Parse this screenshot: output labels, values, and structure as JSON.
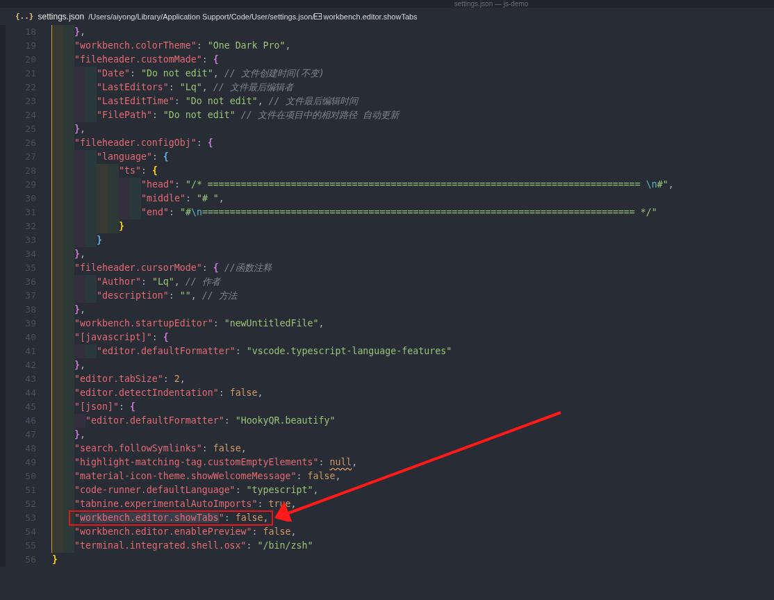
{
  "window": {
    "title": "settings.json — js-demo"
  },
  "breadcrumb": {
    "file_icon": "{..}",
    "file": "settings.json",
    "path": "/Users/aiyong/Library/Application Support/Code/User/settings.json/",
    "symbol": "workbench.editor.showTabs"
  },
  "editor": {
    "lines": [
      {
        "number": "18",
        "tokens": [
          {
            "kind": "close-bracket",
            "text": "}",
            "color": "#c678dd"
          },
          {
            "kind": "punct",
            "text": ","
          }
        ]
      },
      {
        "number": "19",
        "tokens": [
          {
            "kind": "key",
            "text": "\"workbench.colorTheme\""
          },
          {
            "kind": "punct",
            "text": ": "
          },
          {
            "kind": "string",
            "text": "\"One Dark Pro\""
          },
          {
            "kind": "punct",
            "text": ","
          }
        ]
      },
      {
        "number": "20",
        "tokens": [
          {
            "kind": "key",
            "text": "\"fileheader.customMade\""
          },
          {
            "kind": "punct",
            "text": ": "
          },
          {
            "kind": "open-bracket",
            "text": "{",
            "color": "#c678dd"
          }
        ]
      },
      {
        "number": "21",
        "tokens": [
          {
            "kind": "key",
            "text": "\"Date\""
          },
          {
            "kind": "punct",
            "text": ": "
          },
          {
            "kind": "string",
            "text": "\"Do not edit\""
          },
          {
            "kind": "punct",
            "text": ", "
          },
          {
            "kind": "comment",
            "text": "// 文件创建时间(不变)"
          }
        ]
      },
      {
        "number": "22",
        "tokens": [
          {
            "kind": "key",
            "text": "\"LastEditors\""
          },
          {
            "kind": "punct",
            "text": ": "
          },
          {
            "kind": "string",
            "text": "\"Lq\""
          },
          {
            "kind": "punct",
            "text": ", "
          },
          {
            "kind": "comment",
            "text": "// 文件最后编辑者"
          }
        ]
      },
      {
        "number": "23",
        "tokens": [
          {
            "kind": "key",
            "text": "\"LastEditTime\""
          },
          {
            "kind": "punct",
            "text": ": "
          },
          {
            "kind": "string",
            "text": "\"Do not edit\""
          },
          {
            "kind": "punct",
            "text": ", "
          },
          {
            "kind": "comment",
            "text": "// 文件最后编辑时间"
          }
        ]
      },
      {
        "number": "24",
        "tokens": [
          {
            "kind": "key",
            "text": "\"FilePath\""
          },
          {
            "kind": "punct",
            "text": ": "
          },
          {
            "kind": "string",
            "text": "\"Do not edit\" "
          },
          {
            "kind": "comment",
            "text": "// 文件在项目中的相对路径 自动更新"
          }
        ]
      },
      {
        "number": "25",
        "tokens": [
          {
            "kind": "close-bracket",
            "text": "}",
            "color": "#c678dd"
          },
          {
            "kind": "punct",
            "text": ","
          }
        ]
      },
      {
        "number": "26",
        "tokens": [
          {
            "kind": "key",
            "text": "\"fileheader.configObj\""
          },
          {
            "kind": "punct",
            "text": ": "
          },
          {
            "kind": "open-bracket",
            "text": "{",
            "color": "#c678dd"
          }
        ]
      },
      {
        "number": "27",
        "tokens": [
          {
            "kind": "key",
            "text": "\"language\""
          },
          {
            "kind": "punct",
            "text": ": "
          },
          {
            "kind": "open-bracket",
            "text": "{",
            "color": "#61afef"
          }
        ]
      },
      {
        "number": "28",
        "tokens": [
          {
            "kind": "key",
            "text": "\"ts\""
          },
          {
            "kind": "punct",
            "text": ": "
          },
          {
            "kind": "open-bracket",
            "text": "{",
            "color": "#ffd700"
          }
        ]
      },
      {
        "number": "29",
        "tokens": [
          {
            "kind": "key",
            "text": "\"head\""
          },
          {
            "kind": "punct",
            "text": ": "
          },
          {
            "kind": "string",
            "text": "\"/* ============================================================================== "
          },
          {
            "kind": "escape",
            "text": "\\n"
          },
          {
            "kind": "string",
            "text": "#\""
          },
          {
            "kind": "punct",
            "text": ","
          }
        ]
      },
      {
        "number": "30",
        "tokens": [
          {
            "kind": "key",
            "text": "\"middle\""
          },
          {
            "kind": "punct",
            "text": ": "
          },
          {
            "kind": "string",
            "text": "\"# \""
          },
          {
            "kind": "punct",
            "text": ","
          }
        ]
      },
      {
        "number": "31",
        "tokens": [
          {
            "kind": "key",
            "text": "\"end\""
          },
          {
            "kind": "punct",
            "text": ": "
          },
          {
            "kind": "string",
            "text": "\"#"
          },
          {
            "kind": "escape",
            "text": "\\n"
          },
          {
            "kind": "string",
            "text": "============================================================================== */\""
          }
        ]
      },
      {
        "number": "32",
        "tokens": [
          {
            "kind": "close-bracket",
            "text": "}",
            "color": "#ffd700"
          }
        ]
      },
      {
        "number": "33",
        "tokens": [
          {
            "kind": "close-bracket",
            "text": "}",
            "color": "#61afef"
          }
        ]
      },
      {
        "number": "34",
        "tokens": [
          {
            "kind": "close-bracket",
            "text": "}",
            "color": "#c678dd"
          },
          {
            "kind": "punct",
            "text": ","
          }
        ]
      },
      {
        "number": "35",
        "tokens": [
          {
            "kind": "key",
            "text": "\"fileheader.cursorMode\""
          },
          {
            "kind": "punct",
            "text": ": "
          },
          {
            "kind": "open-bracket",
            "text": "{",
            "color": "#c678dd"
          },
          {
            "kind": "comment",
            "text": " //函数注释"
          }
        ]
      },
      {
        "number": "36",
        "tokens": [
          {
            "kind": "key",
            "text": "\"Author\""
          },
          {
            "kind": "punct",
            "text": ": "
          },
          {
            "kind": "string",
            "text": "\"Lq\""
          },
          {
            "kind": "punct",
            "text": ", "
          },
          {
            "kind": "comment",
            "text": "// 作者"
          }
        ]
      },
      {
        "number": "37",
        "tokens": [
          {
            "kind": "key",
            "text": "\"description\""
          },
          {
            "kind": "punct",
            "text": ": "
          },
          {
            "kind": "string",
            "text": "\"\""
          },
          {
            "kind": "punct",
            "text": ", "
          },
          {
            "kind": "comment",
            "text": "// 方法"
          }
        ]
      },
      {
        "number": "38",
        "tokens": [
          {
            "kind": "close-bracket",
            "text": "}",
            "color": "#c678dd"
          },
          {
            "kind": "punct",
            "text": ","
          }
        ]
      },
      {
        "number": "39",
        "tokens": [
          {
            "kind": "key",
            "text": "\"workbench.startupEditor\""
          },
          {
            "kind": "punct",
            "text": ": "
          },
          {
            "kind": "string",
            "text": "\"newUntitledFile\""
          },
          {
            "kind": "punct",
            "text": ","
          }
        ]
      },
      {
        "number": "40",
        "tokens": [
          {
            "kind": "key",
            "text": "\"[javascript]\""
          },
          {
            "kind": "punct",
            "text": ": "
          },
          {
            "kind": "open-bracket",
            "text": "{",
            "color": "#c678dd"
          }
        ]
      },
      {
        "number": "41",
        "tokens": [
          {
            "kind": "key",
            "text": "\"editor.defaultFormatter\""
          },
          {
            "kind": "punct",
            "text": ": "
          },
          {
            "kind": "string",
            "text": "\"vscode.typescript-language-features\""
          }
        ]
      },
      {
        "number": "42",
        "tokens": [
          {
            "kind": "close-bracket",
            "text": "}",
            "color": "#c678dd"
          },
          {
            "kind": "punct",
            "text": ","
          }
        ]
      },
      {
        "number": "43",
        "tokens": [
          {
            "kind": "key",
            "text": "\"editor.tabSize\""
          },
          {
            "kind": "punct",
            "text": ": "
          },
          {
            "kind": "literal",
            "text": "2"
          },
          {
            "kind": "punct",
            "text": ","
          }
        ]
      },
      {
        "number": "44",
        "tokens": [
          {
            "kind": "key",
            "text": "\"editor.detectIndentation\""
          },
          {
            "kind": "punct",
            "text": ": "
          },
          {
            "kind": "literal",
            "text": "false"
          },
          {
            "kind": "punct",
            "text": ","
          }
        ]
      },
      {
        "number": "45",
        "tokens": [
          {
            "kind": "key",
            "text": "\"[json]\""
          },
          {
            "kind": "punct",
            "text": ": "
          },
          {
            "kind": "open-bracket",
            "text": "{",
            "color": "#c678dd"
          }
        ]
      },
      {
        "number": "46",
        "misaligned": true,
        "tokens": [
          {
            "kind": "key",
            "text": "\"editor.defaultFormatter\""
          },
          {
            "kind": "punct",
            "text": ": "
          },
          {
            "kind": "string",
            "text": "\"HookyQR.beautify\""
          }
        ]
      },
      {
        "number": "47",
        "tokens": [
          {
            "kind": "close-bracket",
            "text": "}",
            "color": "#c678dd"
          },
          {
            "kind": "punct",
            "text": ","
          }
        ]
      },
      {
        "number": "48",
        "tokens": [
          {
            "kind": "key",
            "text": "\"search.followSymlinks\""
          },
          {
            "kind": "punct",
            "text": ": "
          },
          {
            "kind": "literal",
            "text": "false"
          },
          {
            "kind": "punct",
            "text": ","
          }
        ]
      },
      {
        "number": "49",
        "tokens": [
          {
            "kind": "key",
            "text": "\"highlight-matching-tag.customEmptyElements\""
          },
          {
            "kind": "punct",
            "text": ": "
          },
          {
            "kind": "literal",
            "text": "null",
            "warning": true
          },
          {
            "kind": "punct",
            "text": ","
          }
        ]
      },
      {
        "number": "50",
        "tokens": [
          {
            "kind": "key",
            "text": "\"material-icon-theme.showWelcomeMessage\""
          },
          {
            "kind": "punct",
            "text": ": "
          },
          {
            "kind": "literal",
            "text": "false"
          },
          {
            "kind": "punct",
            "text": ","
          }
        ]
      },
      {
        "number": "51",
        "tokens": [
          {
            "kind": "key",
            "text": "\"code-runner.defaultLanguage\""
          },
          {
            "kind": "punct",
            "text": ": "
          },
          {
            "kind": "string",
            "text": "\"typescript\""
          },
          {
            "kind": "punct",
            "text": ","
          }
        ]
      },
      {
        "number": "52",
        "tokens": [
          {
            "kind": "key",
            "text": "\"tabnine.experimentalAutoImports\""
          },
          {
            "kind": "punct",
            "text": ": "
          },
          {
            "kind": "literal",
            "text": "true"
          },
          {
            "kind": "punct",
            "text": ","
          }
        ]
      },
      {
        "number": "53",
        "marked": true,
        "tokens": [
          {
            "kind": "key",
            "text": "\""
          },
          {
            "kind": "key",
            "text": "workbench.editor.showTabs",
            "highlighted": true
          },
          {
            "kind": "key",
            "text": "\""
          },
          {
            "kind": "punct",
            "text": ": "
          },
          {
            "kind": "literal",
            "text": "false"
          },
          {
            "kind": "punct",
            "text": ","
          }
        ]
      },
      {
        "number": "54",
        "tokens": [
          {
            "kind": "key",
            "text": "\"workbench.editor.enablePreview\""
          },
          {
            "kind": "punct",
            "text": ": "
          },
          {
            "kind": "literal",
            "text": "false"
          },
          {
            "kind": "punct",
            "text": ","
          }
        ]
      },
      {
        "number": "55",
        "tokens": [
          {
            "kind": "key",
            "text": "\"terminal.integrated.shell.osx\""
          },
          {
            "kind": "punct",
            "text": ": "
          },
          {
            "kind": "string",
            "text": "\"/bin/zsh\""
          }
        ]
      },
      {
        "number": "56",
        "tokens": [
          {
            "kind": "close-bracket",
            "text": "}",
            "color": "#ffd700"
          }
        ]
      }
    ]
  }
}
